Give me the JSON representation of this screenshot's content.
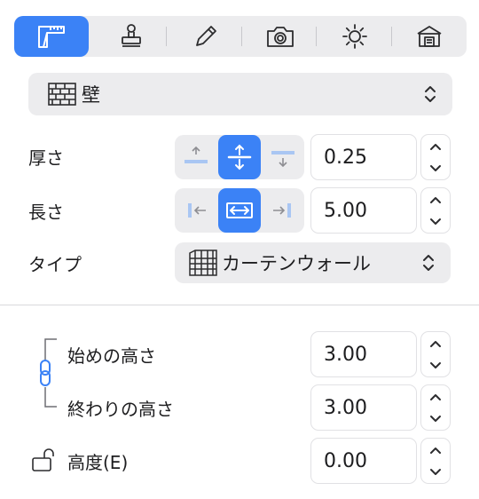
{
  "toolbar": {
    "tools": [
      {
        "icon": "wall-tool-icon",
        "active": true
      },
      {
        "icon": "stamp-icon",
        "active": false
      },
      {
        "icon": "pencil-icon",
        "active": false
      },
      {
        "icon": "camera-icon",
        "active": false
      },
      {
        "icon": "sun-icon",
        "active": false
      },
      {
        "icon": "house-icon",
        "active": false
      }
    ],
    "accent_color": "#3b82f6"
  },
  "object_type": {
    "icon": "brick-wall-icon",
    "label": "壁"
  },
  "thickness": {
    "label": "厚さ",
    "value": "0.25",
    "align_options": [
      "top-align-icon",
      "center-align-icon",
      "bottom-align-icon"
    ],
    "selected": "center-align-icon"
  },
  "length": {
    "label": "長さ",
    "value": "5.00",
    "align_options": [
      "left-align-icon",
      "center-align-icon",
      "right-align-icon"
    ],
    "selected": "center-align-icon"
  },
  "type": {
    "label": "タイプ",
    "icon": "curtain-wall-icon",
    "value": "カーテンウォール"
  },
  "heights": {
    "start_label": "始めの高さ",
    "start_value": "3.00",
    "end_label": "終わりの高さ",
    "end_value": "3.00",
    "link_icon": "chain-link-icon"
  },
  "elevation": {
    "label": "高度(E)",
    "value": "0.00",
    "lock_icon": "unlocked-padlock-icon"
  }
}
